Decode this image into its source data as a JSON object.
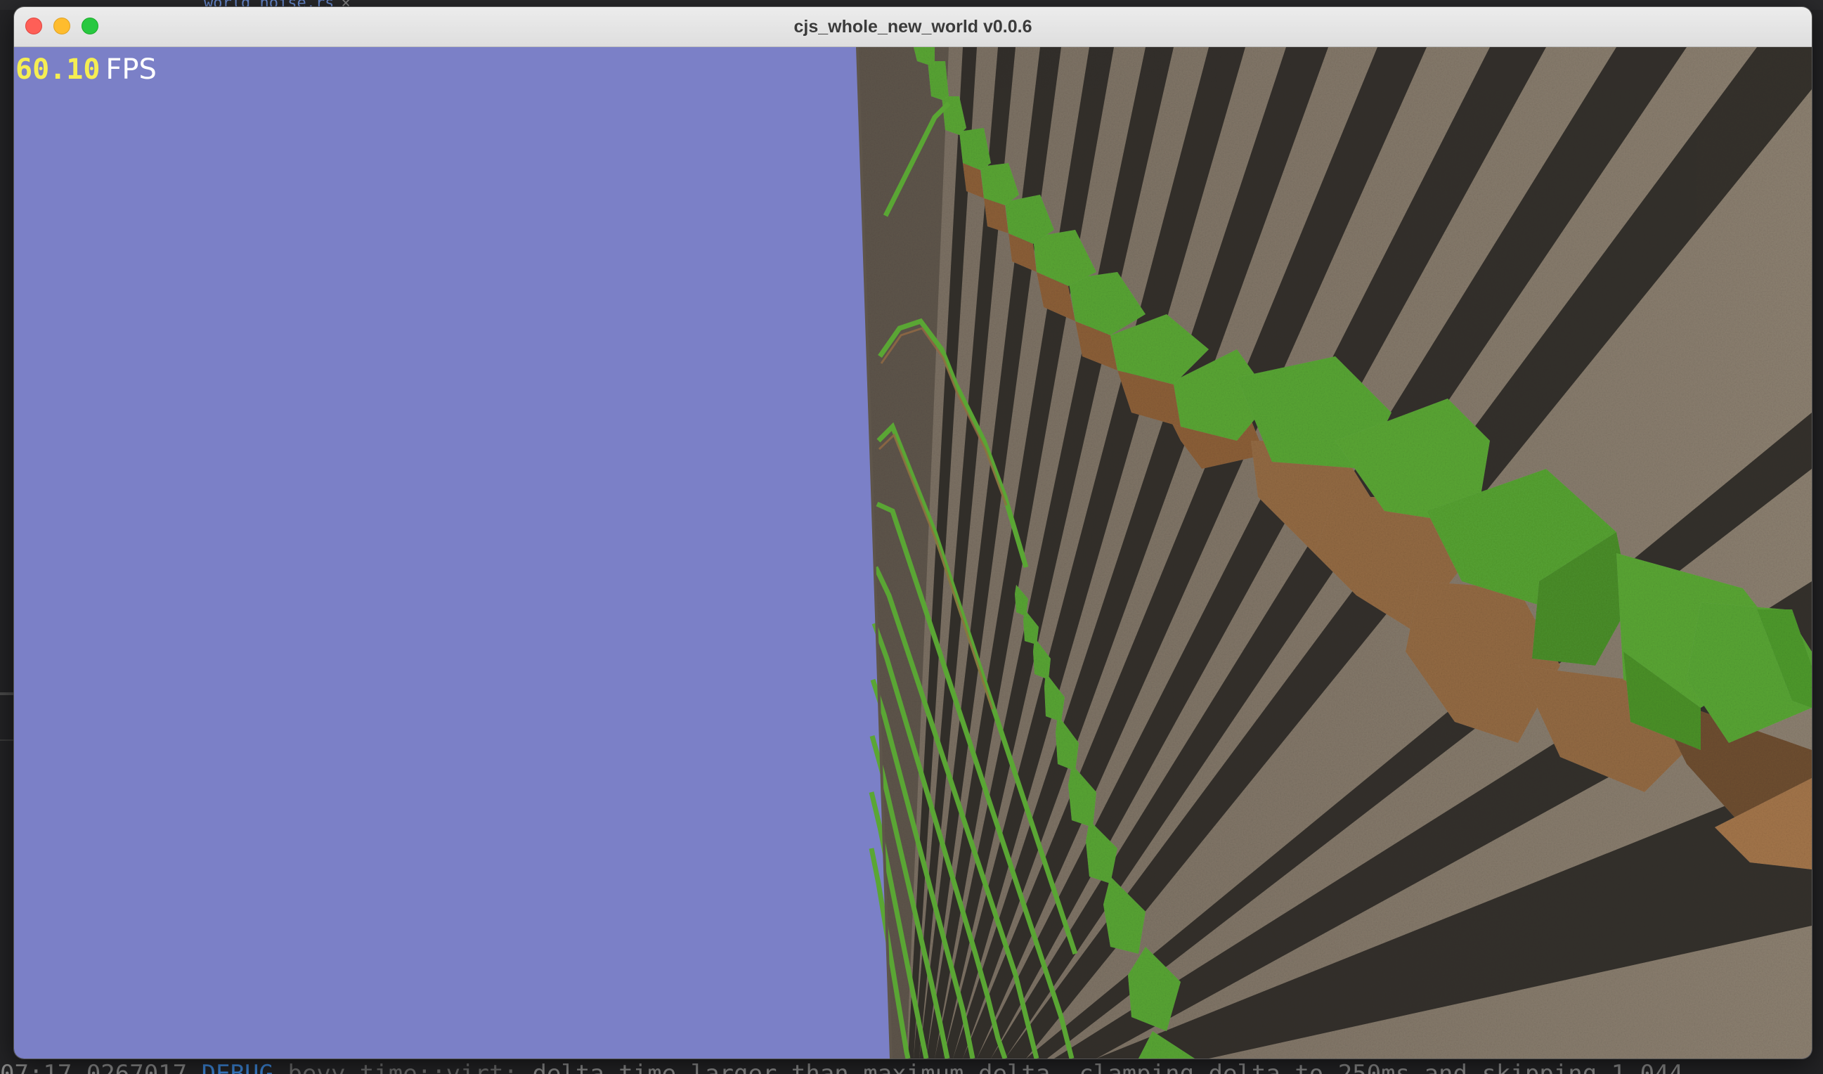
{
  "window": {
    "title": "cjs_whole_new_world v0.0.6"
  },
  "hud": {
    "fps_value": "60.10",
    "fps_label": "FPS"
  },
  "background_editor": {
    "tab_label": "world_noise.rs",
    "tab_close": "×",
    "log_time": "07:17.0267017",
    "log_level": "DEBUG",
    "log_module": "bevy_time::virt:",
    "log_message": "delta time larger than maximum delta, clamping delta to 250ms and skipping 1.044"
  },
  "scene": {
    "sky_color": "#7b80c7",
    "stone_color": "#837666",
    "grass_color": "#58a534",
    "dirt_color": "#936a43",
    "shadow_color": "#2c2925"
  }
}
